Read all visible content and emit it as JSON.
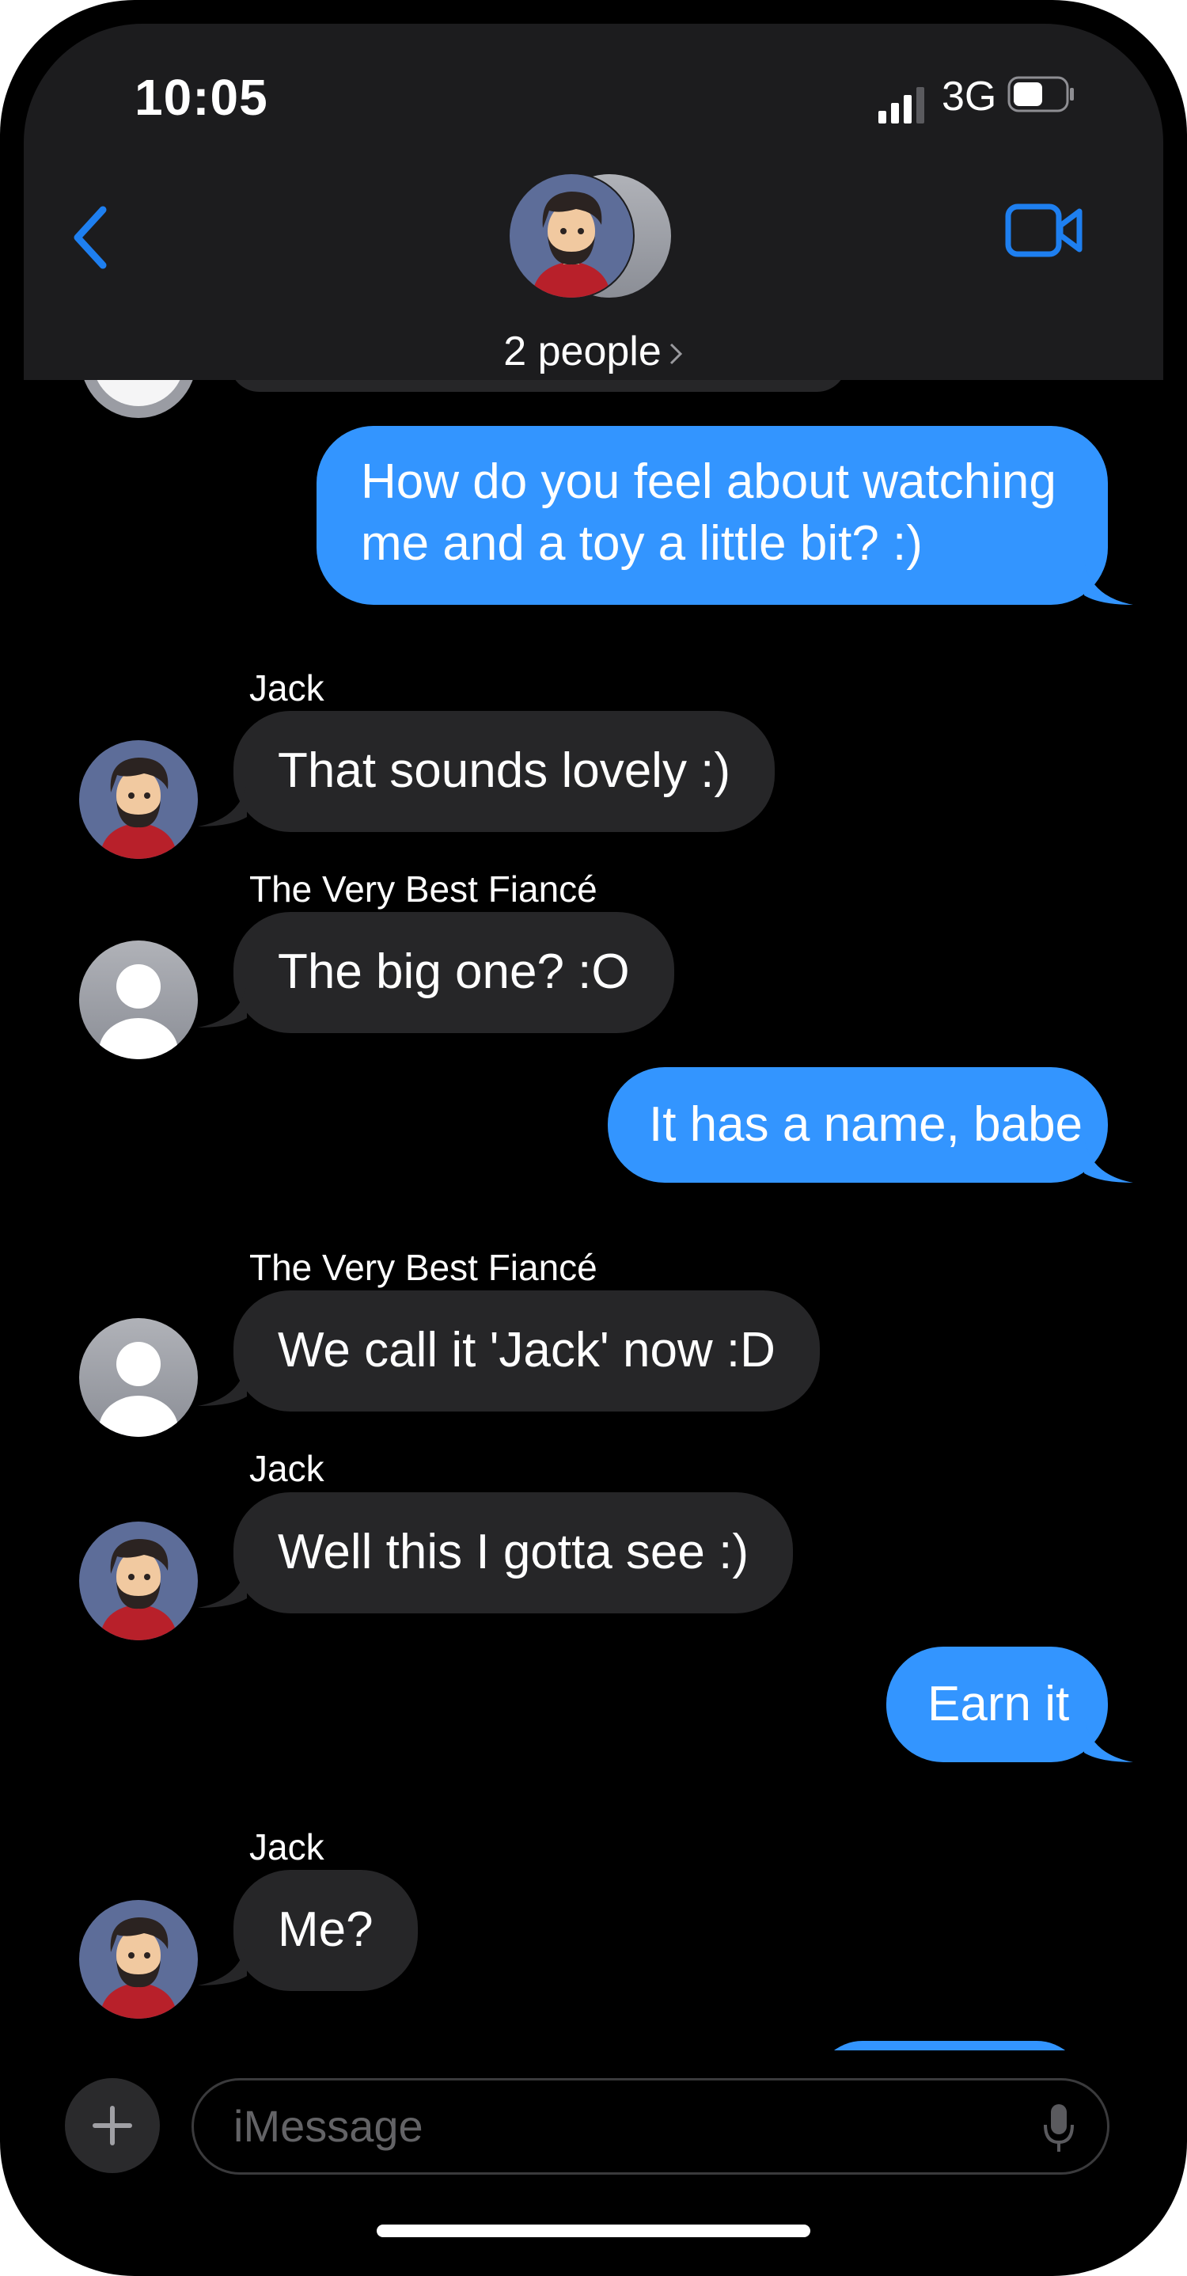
{
  "status_bar": {
    "time": "10:05",
    "network": "3G"
  },
  "header": {
    "title": "2 people"
  },
  "messages": [
    {
      "text_lines": [
        "How do you feel about watching",
        "me and a toy a little bit? :)"
      ]
    },
    {
      "sender": "Jack",
      "text": "That sounds lovely :)"
    },
    {
      "sender": "The Very Best Fiancé",
      "text": "The big one? :O"
    },
    {
      "text": "It has a name, babe"
    },
    {
      "sender": "The Very Best Fiancé",
      "text": "We call it 'Jack' now :D"
    },
    {
      "sender": "Jack",
      "text": "Well this I gotta see :)"
    },
    {
      "text": "Earn it"
    },
    {
      "sender": "Jack",
      "text": "Me?"
    }
  ],
  "composer": {
    "placeholder": "iMessage"
  },
  "colors": {
    "outgoing": "#3395ff",
    "incoming": "#262628",
    "header_bg": "#1c1c1e",
    "accent": "#1e7ff0"
  }
}
